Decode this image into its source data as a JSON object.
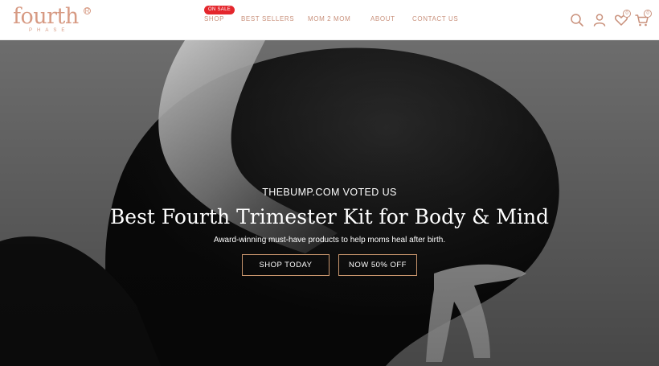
{
  "brand": {
    "name": "fourth",
    "sub": "PHASE",
    "registered": "R",
    "color": "#d79a83"
  },
  "nav": {
    "sale_badge": "ON SALE",
    "items": [
      {
        "label": "SHOP"
      },
      {
        "label": "BEST SELLERS"
      },
      {
        "label": "MOM 2 MOM"
      },
      {
        "label": "ABOUT"
      },
      {
        "label": "CONTACT US"
      }
    ],
    "accent": "#c9917c",
    "badge_color": "#e4262c"
  },
  "header_icons": {
    "search": "search-icon",
    "account": "user-icon",
    "wishlist": "heart-icon",
    "wishlist_count": "0",
    "cart": "cart-icon",
    "cart_count": "0"
  },
  "hero": {
    "eyebrow": "THEBUMP.COM VOTED US",
    "headline": "Best Fourth Trimester Kit for Body & Mind",
    "subtitle": "Award-winning must-have products to help moms heal after birth.",
    "primary_button": "SHOP TODAY",
    "secondary_button": "NOW 50% OFF",
    "button_border": "#c8956d"
  }
}
